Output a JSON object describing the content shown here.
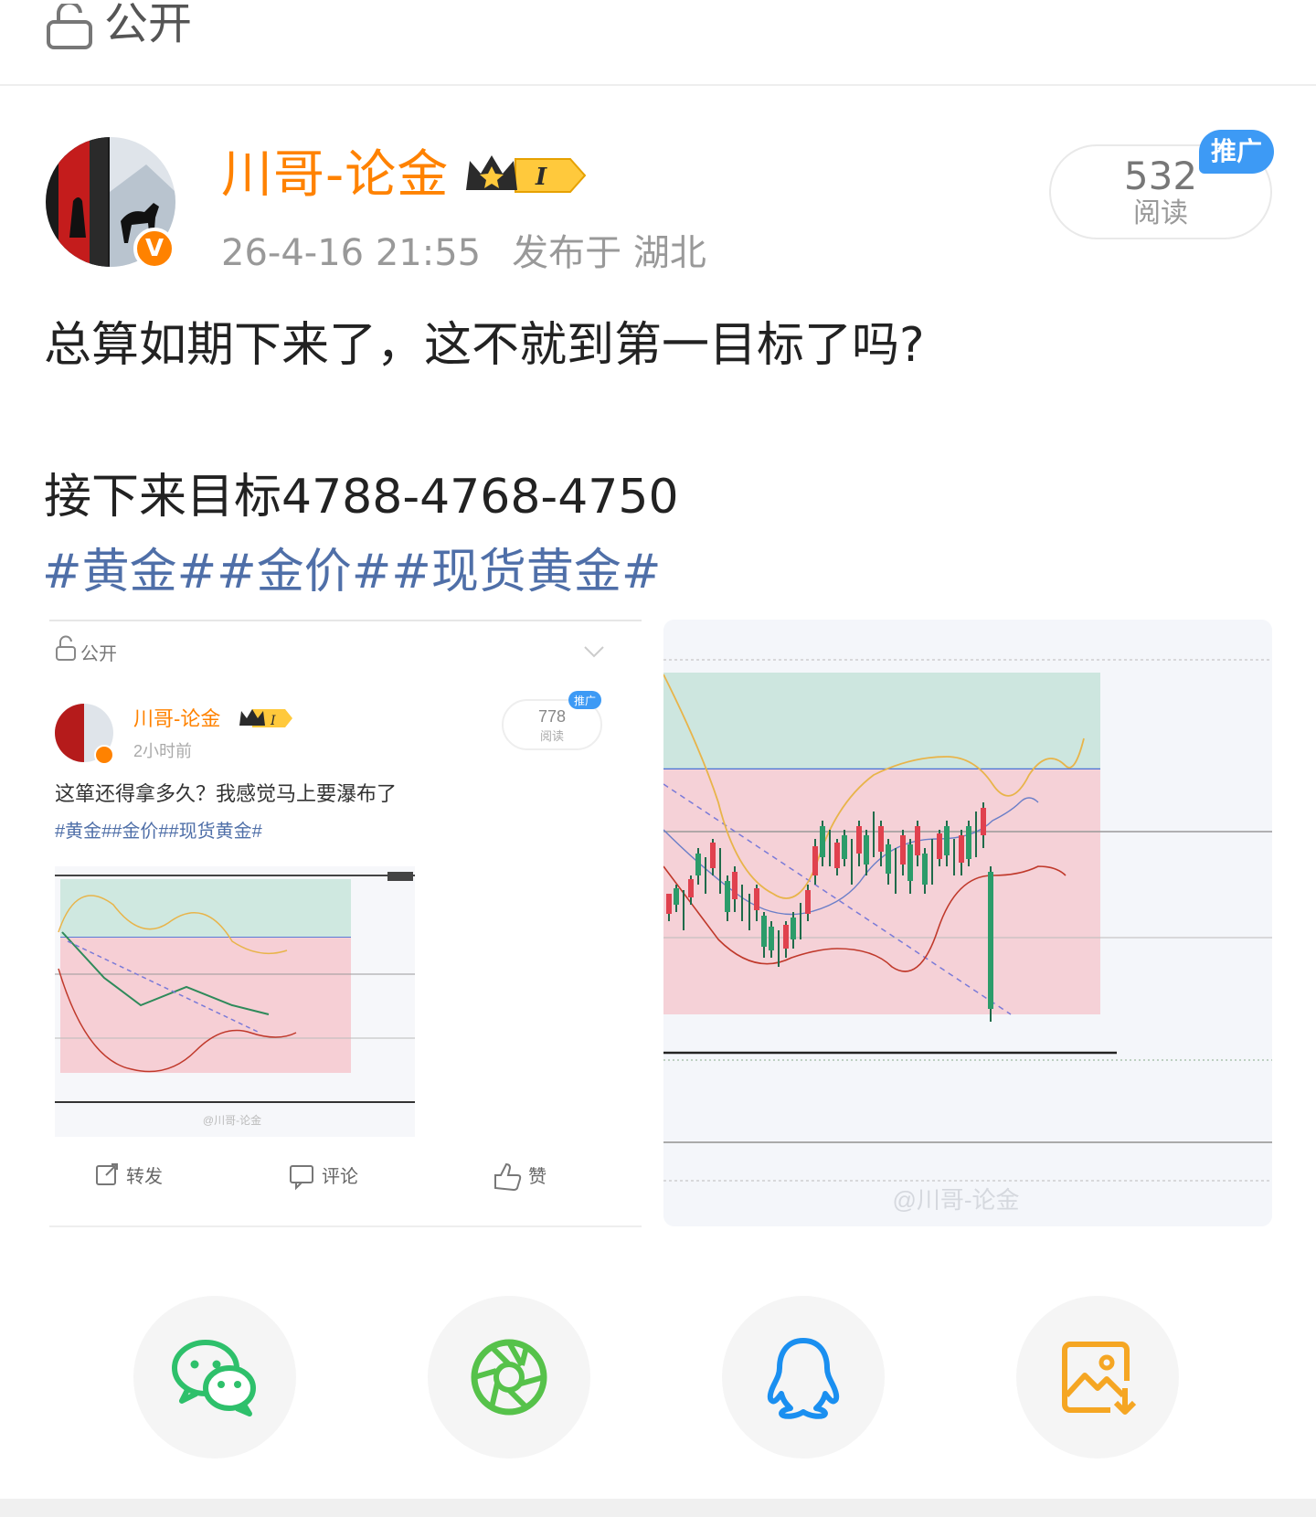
{
  "visibility": {
    "label": "公开"
  },
  "post": {
    "author": "川哥-论金",
    "level_badge": "I",
    "time": "26-4-16 21:55",
    "location": "发布于 湖北",
    "reads": {
      "count": "532",
      "label": "阅读"
    },
    "promo_badge": "推广",
    "text_line1": "总算如期下来了，这不就到第一目标了吗?",
    "text_line2": "接下来目标4788-4768-4750",
    "tags": "#黄金##金价##现货黄金#"
  },
  "embedded_post": {
    "visibility": "公开",
    "author": "川哥-论金",
    "level_badge": "I",
    "time": "2小时前",
    "reads_count": "778",
    "reads_label": "阅读",
    "promo_badge": "推广",
    "text": "这箪还得拿多久？我感觉马上要瀑布了",
    "tags": "#黄金##金价##现货黄金#",
    "actions": {
      "repost": "转发",
      "comment": "评论",
      "like": "赞"
    },
    "watermark": "@川哥-论金"
  },
  "right_image": {
    "watermark": "@川哥-论金"
  },
  "share": {
    "icons": [
      "wechat-icon",
      "moments-icon",
      "qq-icon",
      "save-image-icon"
    ],
    "colors": {
      "wechat": "#2ec06b",
      "moments": "#56c24a",
      "qq": "#1a8ff0",
      "save": "#f5a623"
    }
  },
  "colors": {
    "username": "#ff8200",
    "tags": "#4f6fa8",
    "promo": "#3d9af5"
  }
}
